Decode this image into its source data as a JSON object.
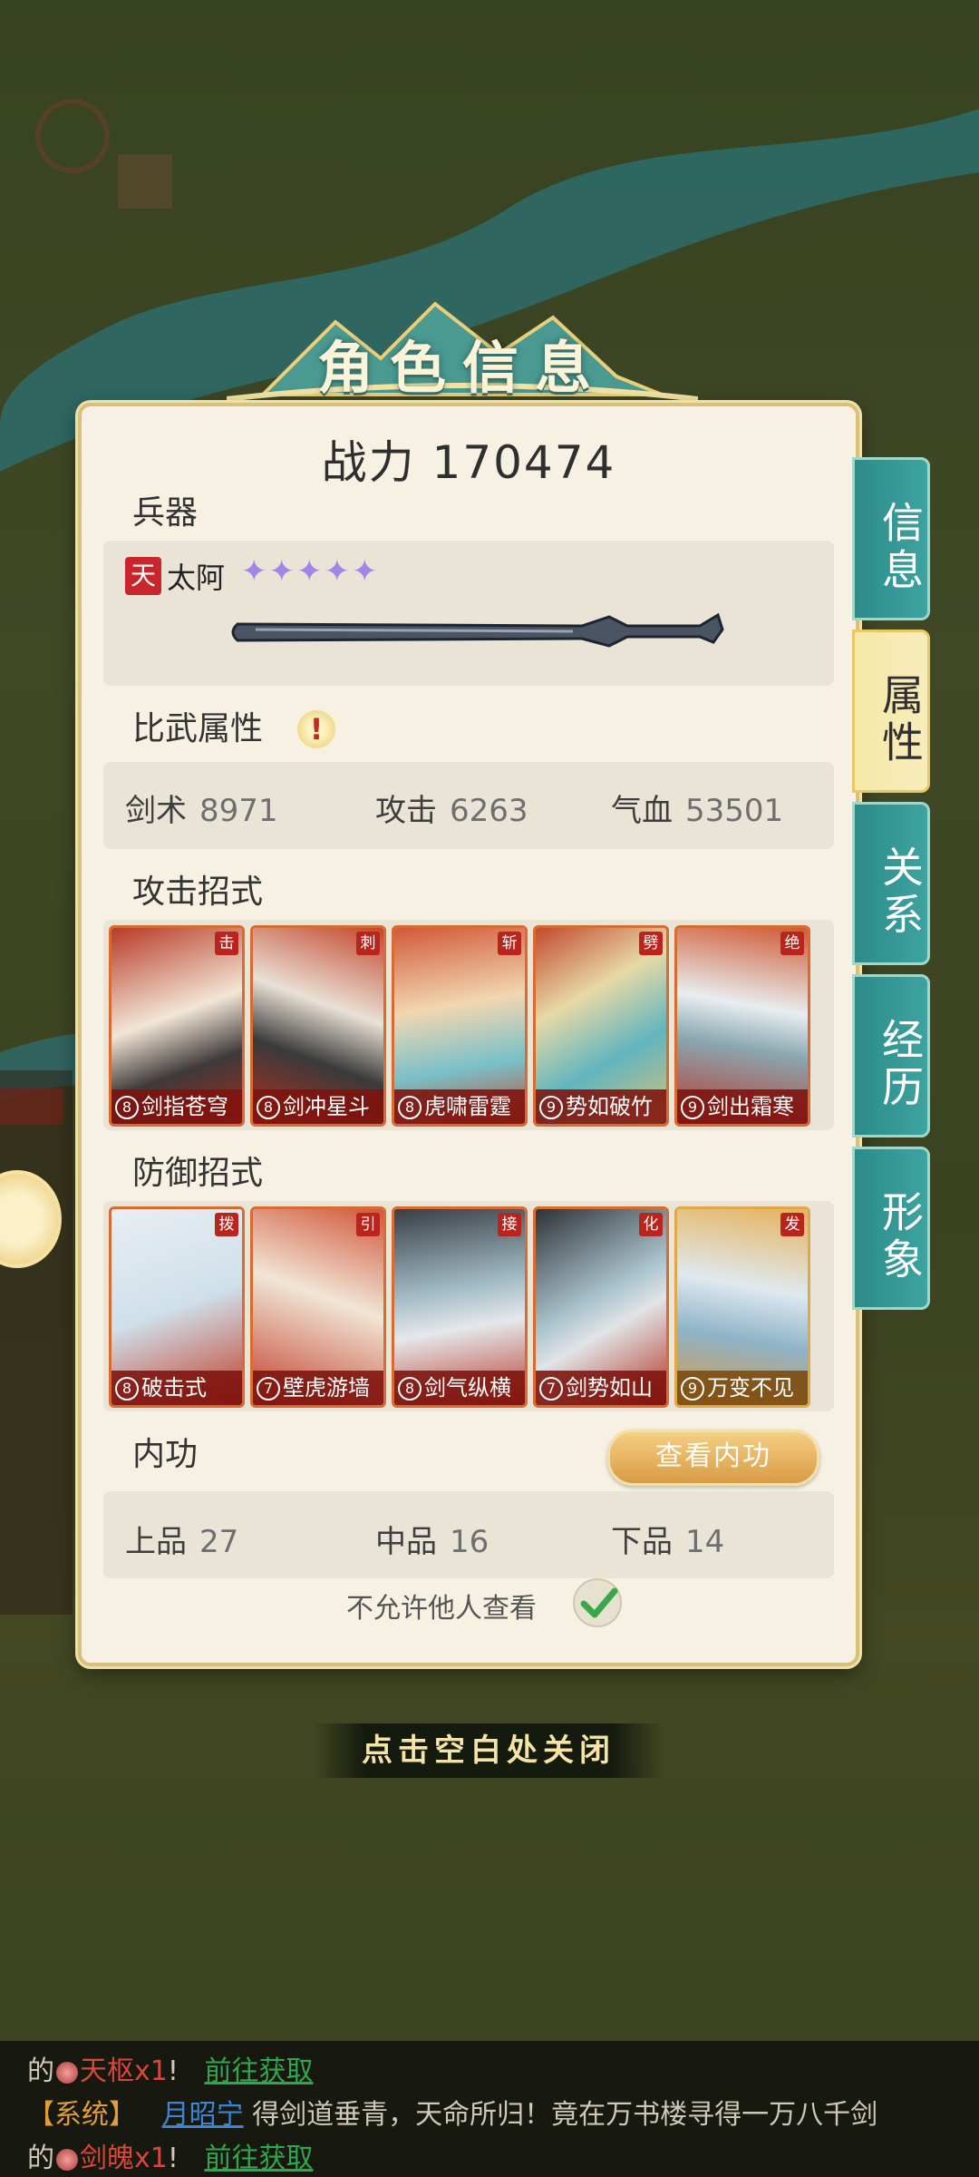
{
  "title": "角色信息",
  "power": "战力 170474",
  "sections": {
    "weapon": "兵器",
    "combat_attrs": "比武属性",
    "attack_moves": "攻击招式",
    "defense_moves": "防御招式",
    "inner_skill": "内功"
  },
  "weapon": {
    "tier": "天",
    "name": "太阿",
    "stars": "✦✦✦✦✦",
    "star_count": 5
  },
  "stats": [
    {
      "label": "剑术",
      "value": "8971"
    },
    {
      "label": "攻击",
      "value": "6263"
    },
    {
      "label": "气血",
      "value": "53501"
    }
  ],
  "attack_cards": [
    {
      "tag": "击",
      "level": "8",
      "name": "剑指苍穹"
    },
    {
      "tag": "刺",
      "level": "8",
      "name": "剑冲星斗"
    },
    {
      "tag": "斩",
      "level": "8",
      "name": "虎啸雷霆"
    },
    {
      "tag": "劈",
      "level": "9",
      "name": "势如破竹"
    },
    {
      "tag": "绝",
      "level": "9",
      "name": "剑出霜寒"
    }
  ],
  "defense_cards": [
    {
      "tag": "拨",
      "level": "8",
      "name": "破击式"
    },
    {
      "tag": "引",
      "level": "7",
      "name": "壁虎游墙"
    },
    {
      "tag": "接",
      "level": "8",
      "name": "剑气纵横"
    },
    {
      "tag": "化",
      "level": "7",
      "name": "剑势如山"
    },
    {
      "tag": "发",
      "level": "9",
      "name": "万变不见"
    }
  ],
  "inner": {
    "view_button": "查看内功",
    "grades": [
      {
        "label": "上品",
        "value": "27"
      },
      {
        "label": "中品",
        "value": "16"
      },
      {
        "label": "下品",
        "value": "14"
      }
    ]
  },
  "privacy_label": "不允许他人查看",
  "privacy_checked": true,
  "tabs": [
    {
      "label": "信息",
      "active": false
    },
    {
      "label": "属性",
      "active": true
    },
    {
      "label": "关系",
      "active": false
    },
    {
      "label": "经历",
      "active": false
    },
    {
      "label": "形象",
      "active": false
    }
  ],
  "close_hint": "点击空白处关闭",
  "chat": {
    "line1_prefix": "的",
    "line1_item": "天枢x1",
    "line1_bang": "!",
    "line1_link": "前往获取",
    "line2_tag": "【系统】",
    "line2_user": "月昭宁",
    "line2_text": "得剑道垂青，天命所归！竟在万书楼寻得一万八千剑",
    "line3_prefix": "的",
    "line3_item": "剑魄x1",
    "line3_bang": "!",
    "line3_link": "前往获取"
  },
  "colors": {
    "card_border": "#d86b2f",
    "tab_teal": "#2c8b8a",
    "tab_active": "#f6e8a8",
    "panel_bg": "#f6f1e2"
  }
}
